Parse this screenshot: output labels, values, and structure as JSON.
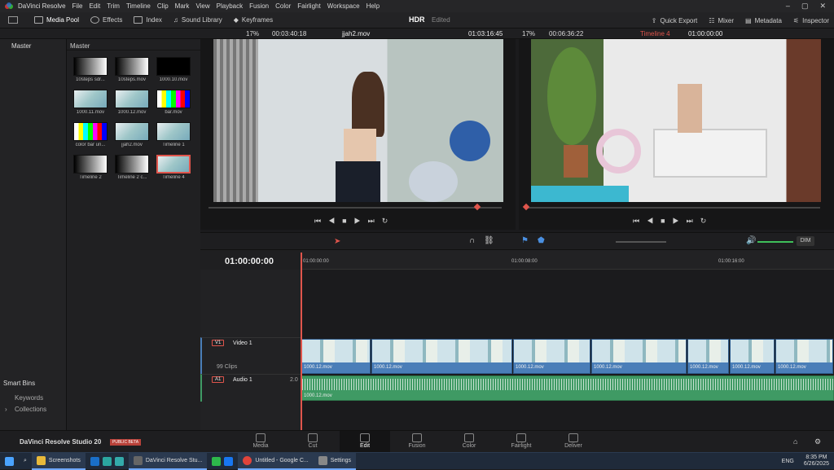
{
  "titlebar": {
    "app_name": "DaVinci Resolve",
    "menus": [
      "File",
      "Edit",
      "Trim",
      "Timeline",
      "Clip",
      "Mark",
      "View",
      "Playback",
      "Fusion",
      "Color",
      "Fairlight",
      "Workspace",
      "Help"
    ]
  },
  "toolbar": {
    "media_pool": "Media Pool",
    "effects": "Effects",
    "index": "Index",
    "sound_library": "Sound Library",
    "keyframes": "Keyframes",
    "hdr": "HDR",
    "edited": "Edited",
    "quick_export": "Quick Export",
    "mixer": "Mixer",
    "metadata": "Metadata",
    "inspector": "Inspector"
  },
  "source_viewer": {
    "zoom": "17%",
    "duration": "00:03:40:18",
    "clip": "jjah2.mov",
    "timecode": "01:03:16:45"
  },
  "timeline_viewer": {
    "zoom": "17%",
    "duration": "00:06:36:22",
    "timeline": "Timeline 4",
    "timecode": "01:00:00:00"
  },
  "bins": {
    "header": "Master",
    "smart_bins": "Smart Bins",
    "keywords": "Keywords",
    "collections": "Collections"
  },
  "media_pool": {
    "header": "Master",
    "clips": [
      {
        "label": "10steps sdr...",
        "kind": "steps"
      },
      {
        "label": "10steps.mov",
        "kind": "steps"
      },
      {
        "label": "1000.10.mov",
        "kind": "audio"
      },
      {
        "label": "1000.11.mov",
        "kind": "photo"
      },
      {
        "label": "1000.12.mov",
        "kind": "photo"
      },
      {
        "label": "bar.mov",
        "kind": "bars"
      },
      {
        "label": "color bar un...",
        "kind": "bars"
      },
      {
        "label": "jjah2.mov",
        "kind": "photo"
      },
      {
        "label": "Timeline 1",
        "kind": "photo"
      },
      {
        "label": "Timeline 2",
        "kind": "timeline"
      },
      {
        "label": "Timeline 2 c...",
        "kind": "timeline"
      },
      {
        "label": "Timeline 4",
        "kind": "photo",
        "selected": true
      }
    ]
  },
  "timeline": {
    "timecode": "01:00:00:00",
    "ruler": [
      "01:00:00:00",
      "01:00:08:00",
      "01:00:16:00"
    ],
    "video_track": {
      "tag": "V1",
      "name": "Video 1",
      "clips_count": "99 Clips"
    },
    "audio_track": {
      "tag": "A1",
      "name": "Audio 1",
      "channels": "2.0"
    },
    "video_clips": [
      "1000.12.mov",
      "1000.12.mov",
      "1000.12.mov",
      "1000.12.mov",
      "1000.12.mov",
      "1000.12.mov",
      "1000.12.mov"
    ],
    "audio_clip": "1000.12.mov",
    "dim": "DIM"
  },
  "branding": {
    "product": "DaVinci Resolve Studio 20",
    "badge": "PUBLIC BETA"
  },
  "pages": [
    "Media",
    "Cut",
    "Edit",
    "Fusion",
    "Color",
    "Fairlight",
    "Deliver"
  ],
  "active_page": "Edit",
  "taskbar": {
    "items": [
      {
        "label": "Screenshots",
        "open": true
      },
      {
        "label": "DaVinci Resolve Stu...",
        "open": true
      },
      {
        "label": "Untitled - Google C...",
        "open": true
      },
      {
        "label": "Settings",
        "open": true
      }
    ],
    "lang": "ENG",
    "time": "8:35 PM",
    "date": "6/26/2025"
  },
  "colors": {
    "accent_red": "#e0554c",
    "video_track": "#4a7eb8",
    "audio_track": "#3f9a64",
    "active_tab": "#ffffff"
  }
}
